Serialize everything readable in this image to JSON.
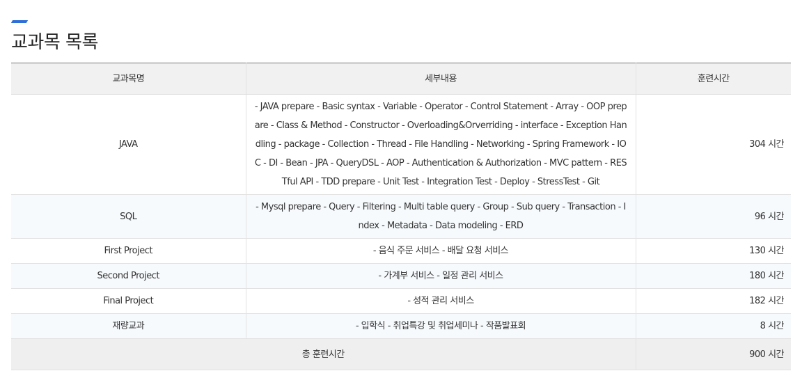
{
  "title": "교과목 목록",
  "columns": {
    "name": "교과목명",
    "detail": "세부내용",
    "hours": "훈련시간"
  },
  "rows": [
    {
      "name": "JAVA",
      "detail": "- JAVA prepare - Basic syntax - Variable - Operator - Control Statement - Array - OOP prepare - Class & Method - Constructor - Overloading&Orverriding - interface - Exception Handling - package - Collection - Thread - File Handling - Networking - Spring Framework - IOC - DI - Bean - JPA - QueryDSL - AOP - Authentication & Authorization - MVC pattern - RESTful API - TDD prepare - Unit Test - Integration Test - Deploy - StressTest - Git",
      "hours": "304 시간"
    },
    {
      "name": "SQL",
      "detail": "- Mysql prepare - Query - Filtering - Multi table query - Group - Sub query - Transaction - Index - Metadata - Data modeling - ERD",
      "hours": "96 시간"
    },
    {
      "name": "First Project",
      "detail": "- 음식 주문 서비스 - 배달 요청 서비스",
      "hours": "130 시간"
    },
    {
      "name": "Second Project",
      "detail": "- 가계부 서비스 - 일정 관리 서비스",
      "hours": "180 시간"
    },
    {
      "name": "Final Project",
      "detail": "- 성적 관리 서비스",
      "hours": "182 시간"
    },
    {
      "name": "재량교과",
      "detail": "- 입학식 - 취업특강 및 취업세미나 - 작품발표회",
      "hours": "8 시간"
    }
  ],
  "total": {
    "label": "총 훈련시간",
    "hours": "900 시간"
  },
  "colors": {
    "accent": "#2f6fd6",
    "header_bg": "#f1f1f1",
    "alt_row_bg": "#f7fafd",
    "total_bg": "#efefef"
  }
}
